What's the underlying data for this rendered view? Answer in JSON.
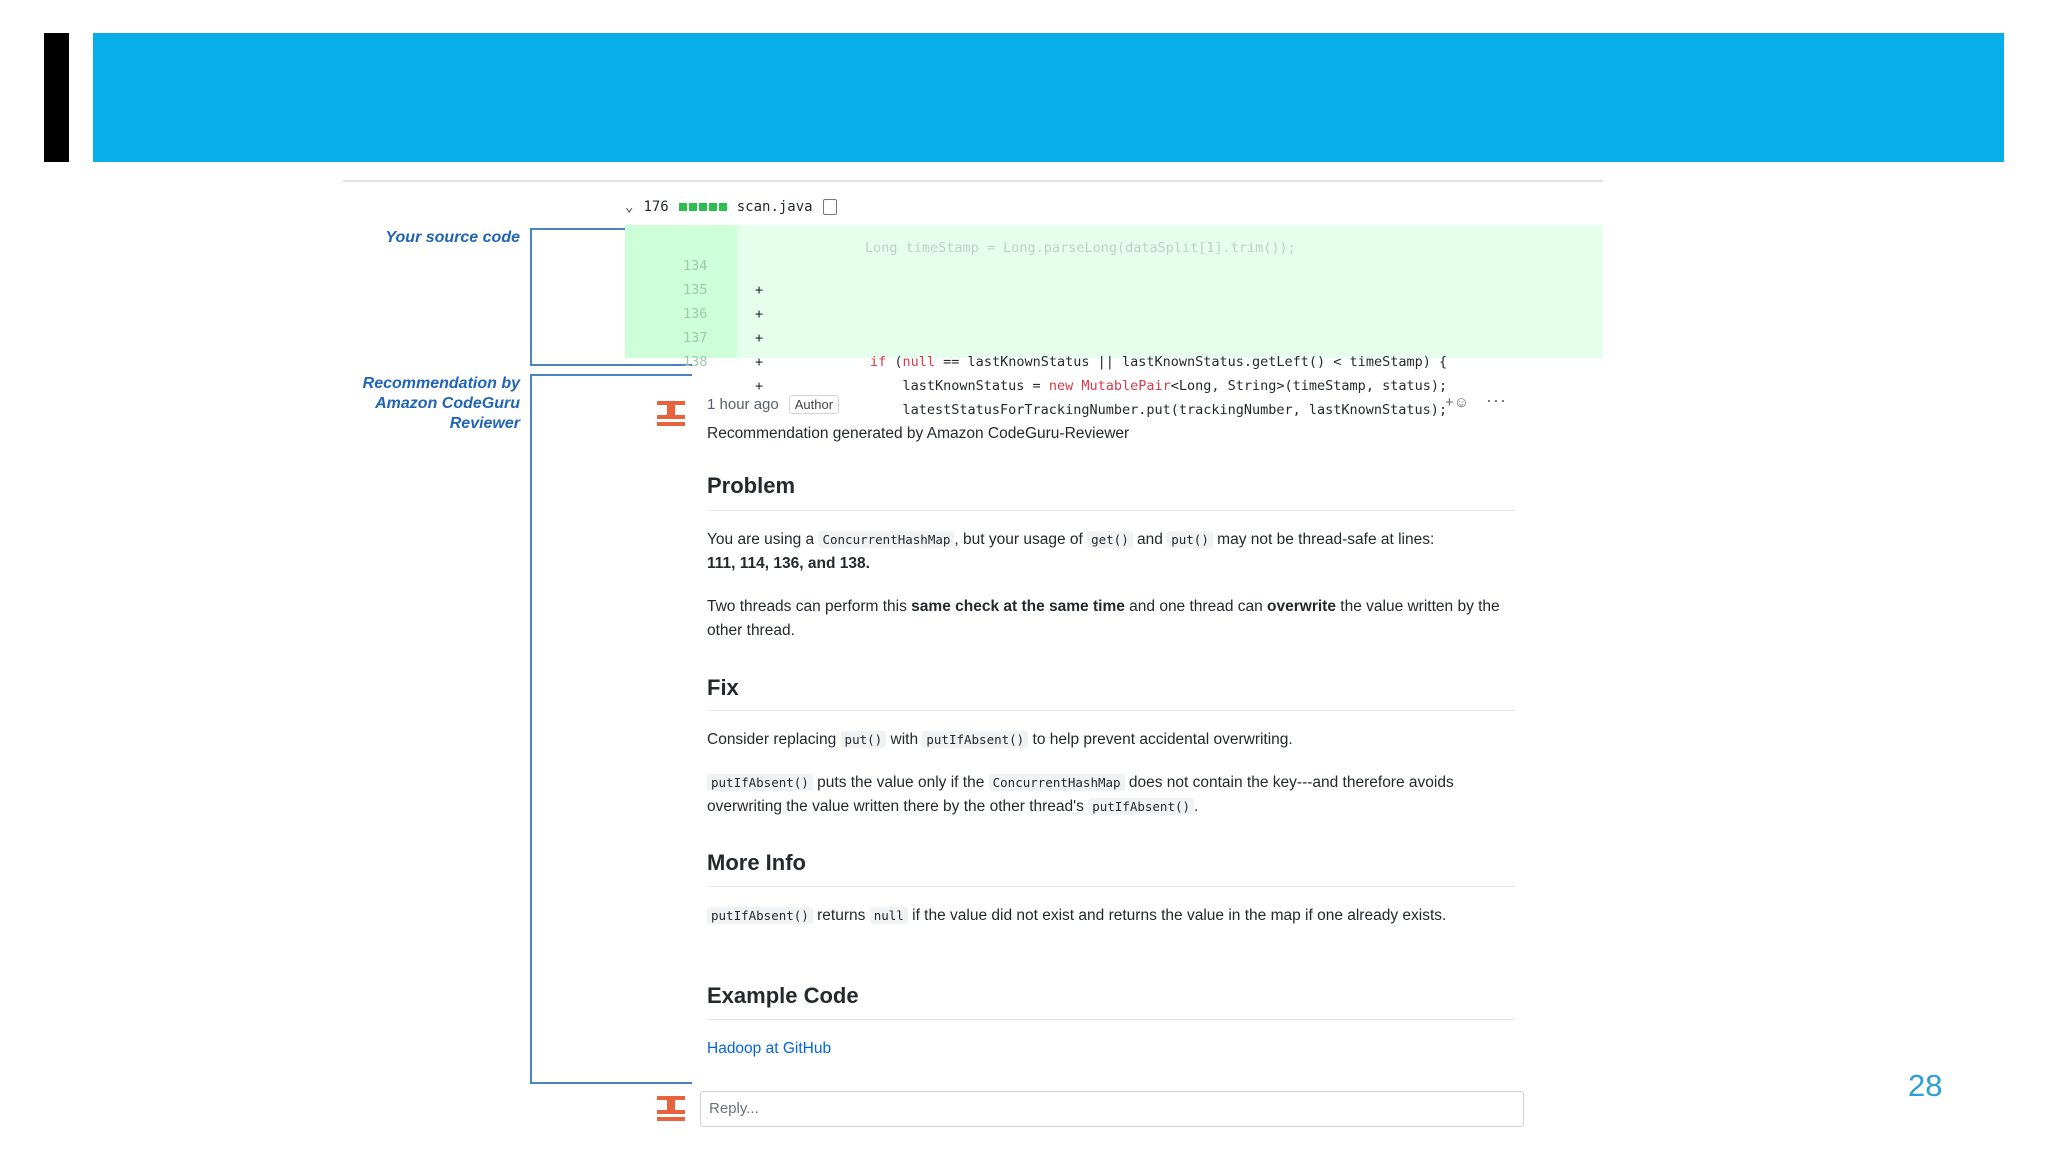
{
  "slide": {
    "page_number": "28",
    "colors": {
      "banner": "#08aeea",
      "side_bar": "#000000",
      "annotation": "#1f64b6"
    }
  },
  "annotations": {
    "source_label": "Your source code",
    "recommendation_label_lines": [
      "Recommendation by",
      "Amazon CodeGuru",
      "Reviewer"
    ]
  },
  "diff": {
    "changes_count": "176",
    "filename": "scan.java",
    "lines": [
      {
        "num": "134",
        "marker": "+",
        "code": ""
      },
      {
        "num": "135",
        "marker": "+",
        "code": ""
      },
      {
        "num": "136",
        "marker": "+",
        "code_parts": [
          "if",
          " (",
          "null",
          " == lastKnownStatus || lastKnownStatus.getLeft() < timeStamp) {"
        ]
      },
      {
        "num": "137",
        "marker": "+",
        "code_parts": [
          "    lastKnownStatus = ",
          "new",
          " ",
          "MutablePair",
          "<Long, String>(timeStamp, status);"
        ]
      },
      {
        "num": "138",
        "marker": "+",
        "code": "    latestStatusForTrackingNumber.put(trackingNumber, lastKnownStatus);"
      }
    ]
  },
  "comment": {
    "time": "1 hour ago",
    "author_badge": "Author",
    "reaction": "+☺",
    "more": "···",
    "generated_by": "Recommendation generated by Amazon CodeGuru-Reviewer",
    "problem": {
      "heading": "Problem",
      "p1": {
        "t1": "You are using a ",
        "c1": "ConcurrentHashMap",
        "t2": ", but your usage of ",
        "c2": "get()",
        "t3": " and ",
        "c3": "put()",
        "t4": " may not be thread-safe at lines:",
        "bold": "111, 114, 136, and 138."
      },
      "p2": {
        "t1": "Two threads can perform this ",
        "b1": "same check at the same time",
        "t2": " and one thread can ",
        "b2": "overwrite",
        "t3": " the value written by the other thread."
      }
    },
    "fix": {
      "heading": "Fix",
      "p1": {
        "t1": "Consider replacing ",
        "c1": "put()",
        "t2": " with ",
        "c2": "putIfAbsent()",
        "t3": " to help prevent accidental overwriting."
      },
      "p2": {
        "c1": "putIfAbsent()",
        "t1": " puts the value only if the ",
        "c2": "ConcurrentHashMap",
        "t2": " does not contain the key---and therefore avoids overwriting the value written there by the other thread's ",
        "c3": "putIfAbsent()",
        "t3": "."
      }
    },
    "more_info": {
      "heading": "More Info",
      "p1": {
        "c1": "putIfAbsent()",
        "t1": " returns ",
        "c2": "null",
        "t2": " if the value did not exist and returns the value in the map if one already exists."
      }
    },
    "example": {
      "heading": "Example Code",
      "link_text": "Hadoop at GitHub"
    }
  },
  "reply": {
    "placeholder": "Reply..."
  }
}
